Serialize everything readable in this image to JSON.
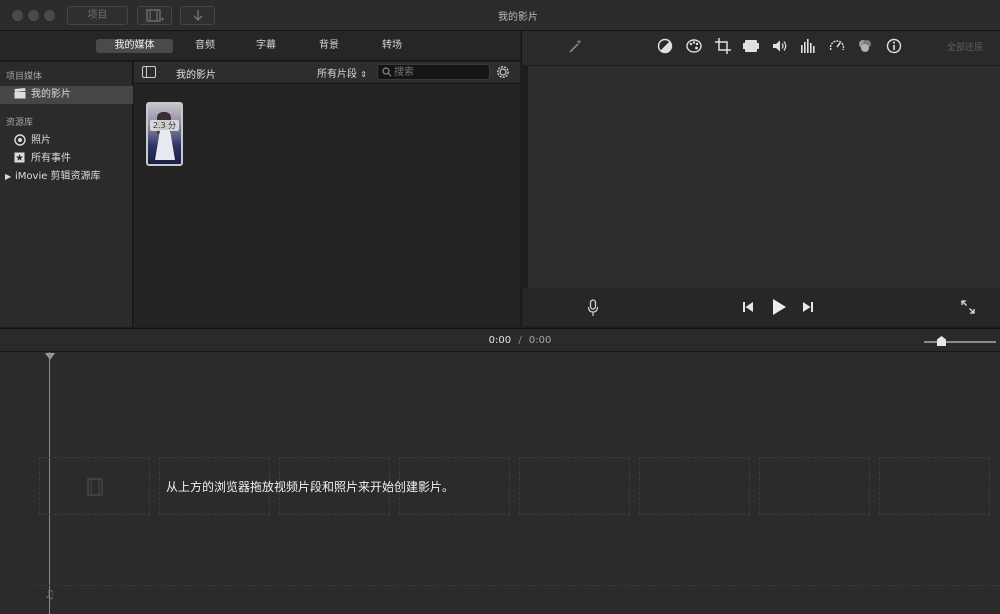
{
  "window": {
    "title": "我的影片",
    "back_button_label": "项目"
  },
  "media_tabs": [
    {
      "label": "我的媒体"
    },
    {
      "label": "音频"
    },
    {
      "label": "字幕"
    },
    {
      "label": "背景"
    },
    {
      "label": "转场"
    }
  ],
  "sidebar": {
    "section1_title": "项目媒体",
    "project_item": "我的影片",
    "section2_title": "资源库",
    "items": [
      {
        "label": "照片",
        "icon": "photos-icon"
      },
      {
        "label": "所有事件",
        "icon": "star-icon"
      }
    ],
    "library_label": "iMovie 剪辑资源库"
  },
  "browser": {
    "title": "我的影片",
    "filter_label": "所有片段",
    "search_placeholder": "搜索",
    "clip": {
      "duration": "2.3 分"
    }
  },
  "viewer": {
    "reset_label": "全部还原"
  },
  "timeline": {
    "current_time": "0:00",
    "separator": "/",
    "total_time": "0:00",
    "zoom_level": 0.2,
    "hint": "从上方的浏览器拖放视频片段和照片来开始创建影片。"
  }
}
